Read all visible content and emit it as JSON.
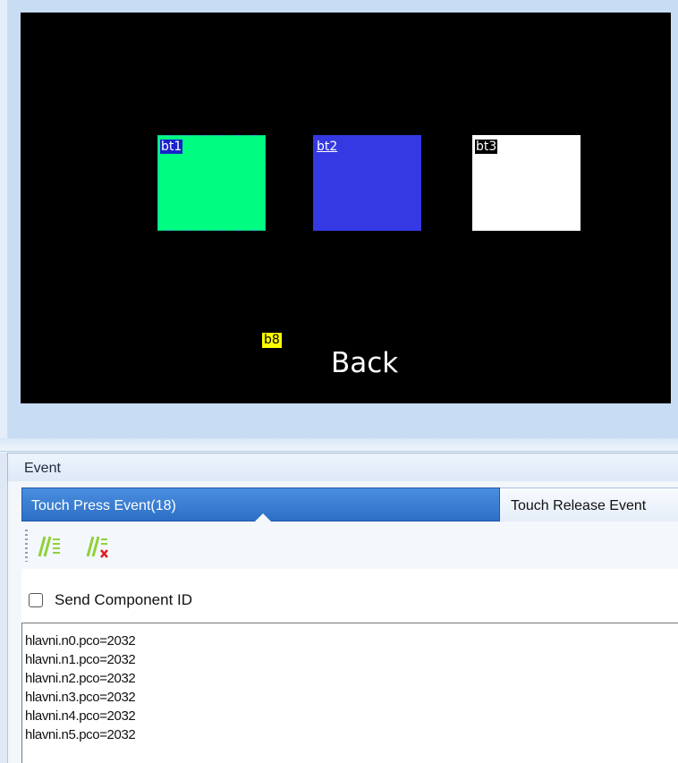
{
  "canvas": {
    "components": [
      {
        "id": "bt1",
        "color": "#00fd82"
      },
      {
        "id": "bt2",
        "color": "#3439e3"
      },
      {
        "id": "bt3",
        "color": "#ffffff"
      }
    ],
    "b8_label": "b8",
    "back_text": "Back"
  },
  "event_panel": {
    "title": "Event",
    "tabs": [
      {
        "label": "Touch Press Event(18)",
        "selected": true
      },
      {
        "label": "Touch Release Event",
        "selected": false
      }
    ],
    "toolbar": {
      "buttons": [
        {
          "icon": "format-code-icon"
        },
        {
          "icon": "clear-code-icon"
        }
      ]
    },
    "send_component_id": {
      "label": "Send Component ID",
      "checked": false
    },
    "code_lines": [
      "hlavni.n0.pco=2032",
      "hlavni.n1.pco=2032",
      "hlavni.n2.pco=2032",
      "hlavni.n3.pco=2032",
      "hlavni.n4.pco=2032",
      "hlavni.n5.pco=2032"
    ]
  },
  "colors": {
    "tab_active": "#2d6fc5",
    "editor_bg": "#c8dcf4",
    "canvas_bg": "#000000"
  }
}
